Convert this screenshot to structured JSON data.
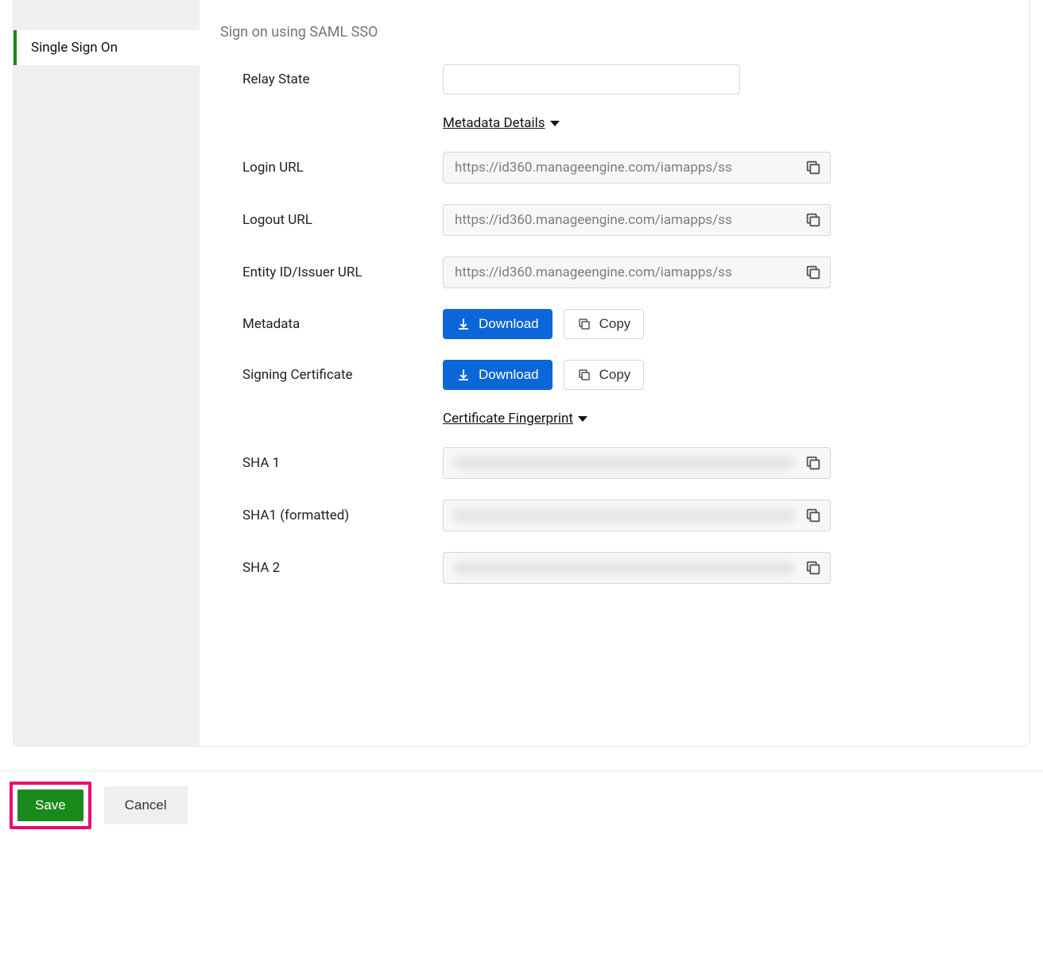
{
  "sidebar": {
    "active": "Single Sign On"
  },
  "header": {
    "subtitle": "Sign on using SAML SSO"
  },
  "fields": {
    "relay_state_label": "Relay State",
    "relay_state_value": "",
    "metadata_details": "Metadata Details",
    "login_url_label": "Login URL",
    "login_url_value": "https://id360.manageengine.com/iamapps/ss",
    "logout_url_label": "Logout URL",
    "logout_url_value": "https://id360.manageengine.com/iamapps/ss",
    "entity_id_label": "Entity ID/Issuer URL",
    "entity_id_value": "https://id360.manageengine.com/iamapps/ss",
    "metadata_label": "Metadata",
    "signing_cert_label": "Signing Certificate",
    "certificate_fingerprint": "Certificate Fingerprint",
    "sha1_label": "SHA 1",
    "sha1f_label": "SHA1 (formatted)",
    "sha2_label": "SHA 2"
  },
  "buttons": {
    "download": "Download",
    "copy": "Copy",
    "save": "Save",
    "cancel": "Cancel"
  }
}
